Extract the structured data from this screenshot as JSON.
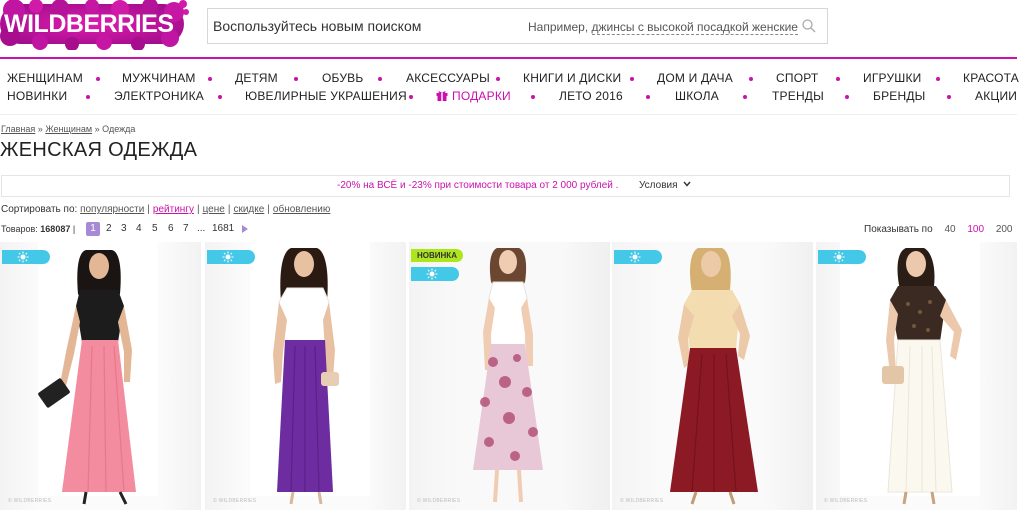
{
  "header": {
    "logo_text": "WILDBERRIES",
    "search_placeholder": "Воспользуйтесь новым поиском",
    "search_example_prefix": "Например,",
    "search_example_link": "джинсы с высокой посадкой женские"
  },
  "nav": {
    "row1": [
      "ЖЕНЩИНАМ",
      "МУЖЧИНАМ",
      "ДЕТЯМ",
      "ОБУВЬ",
      "АКСЕССУАРЫ",
      "КНИГИ И ДИСКИ",
      "ДОМ И ДАЧА",
      "СПОРТ",
      "ИГРУШКИ",
      "КРАСОТА"
    ],
    "row2": [
      "НОВИНКИ",
      "ЭЛЕКТРОНИКА",
      "ЮВЕЛИРНЫЕ УКРАШЕНИЯ",
      "ПОДАРКИ",
      "ЛЕТО 2016",
      "ШКОЛА",
      "ТРЕНДЫ",
      "БРЕНДЫ",
      "АКЦИИ"
    ]
  },
  "breadcrumb": {
    "home": "Главная",
    "sep": "»",
    "women": "Женщинам",
    "current": "Одежда"
  },
  "page_title": "ЖЕНСКАЯ ОДЕЖДА",
  "promo": {
    "text": "-20% на ВСЁ и -23% при стоимости товара от 2 000 рублей .",
    "conditions": "Условия"
  },
  "sort": {
    "label": "Сортировать по:",
    "options": [
      "популярности",
      "рейтингу",
      "цене",
      "скидке",
      "обновлению"
    ]
  },
  "count": {
    "label": "Товаров:",
    "value": "168087"
  },
  "pagination": {
    "pages": [
      "1",
      "2",
      "3",
      "4",
      "5",
      "6",
      "7",
      "...",
      "1681"
    ],
    "active": "1"
  },
  "per_page": {
    "label": "Показывать по",
    "options": [
      "40",
      "100",
      "200"
    ],
    "active": "100"
  },
  "products": [
    {
      "badge": "sun",
      "new_label": "",
      "watermark": "© WILDBERRIES",
      "top_color": "#1c1c1c",
      "bottom_color": "#f28c9e",
      "accessory": "clutch-black"
    },
    {
      "badge": "sun",
      "new_label": "",
      "watermark": "© WILDBERRIES",
      "top_color": "#ffffff",
      "bottom_color": "#6d2c9f",
      "accessory": "clutch-beige"
    },
    {
      "badge": "new+sun",
      "new_label": "НОВИНКА",
      "watermark": "© WILDBERRIES",
      "top_color": "#ffffff",
      "bottom_color": "#e8c8d6",
      "accessory": "none"
    },
    {
      "badge": "sun",
      "new_label": "",
      "watermark": "© WILDBERRIES",
      "top_color": "#f3ddb0",
      "bottom_color": "#8b1a25",
      "accessory": "none"
    },
    {
      "badge": "sun",
      "new_label": "",
      "watermark": "© WILDBERRIES",
      "top_color": "#3a2a22",
      "bottom_color": "#fbf8f0",
      "accessory": "clutch-beige"
    }
  ],
  "colors": {
    "brand": "#cb11ab",
    "accent_badge": "#44c8e8",
    "new_badge": "#aee61d",
    "active_page": "#a78ad6"
  },
  "icons": [
    "wildberries-logo",
    "search-icon",
    "gift-icon",
    "chevron-down-icon",
    "sun-icon",
    "pager-next-icon"
  ]
}
